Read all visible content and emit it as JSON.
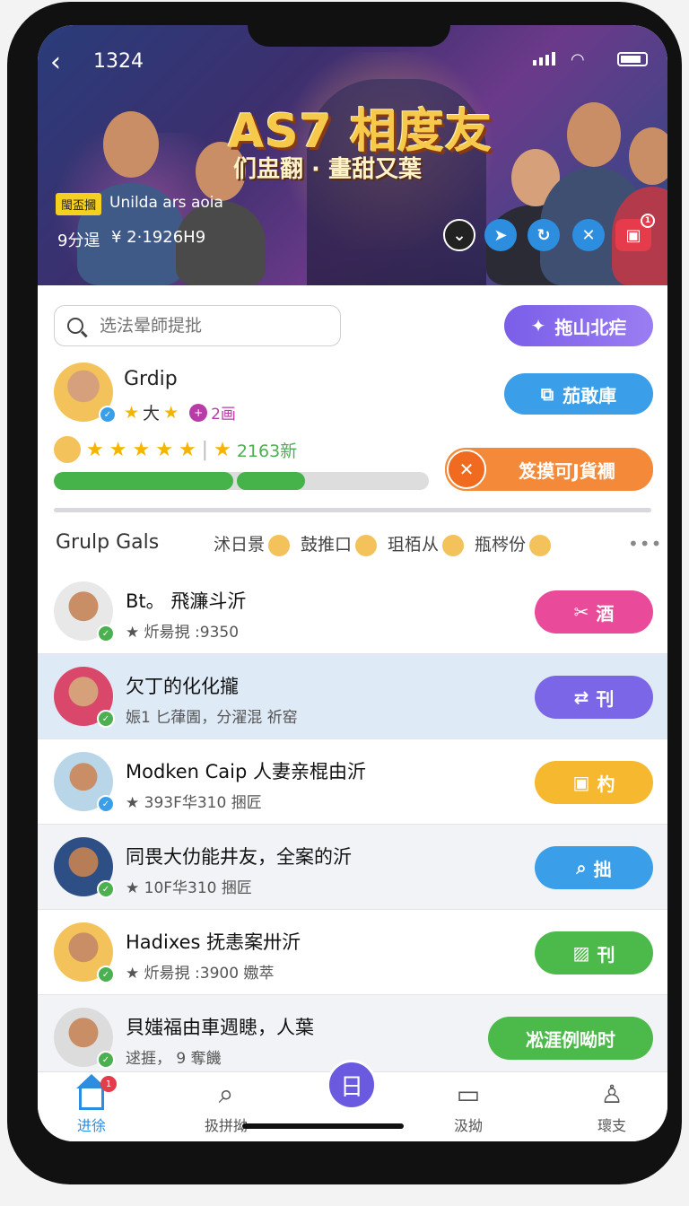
{
  "status": {
    "time": "1324"
  },
  "banner": {
    "title": "AS7 相度友",
    "subtitle": "们盅翻 · 畫甜又葉",
    "tag": "閩盃摑",
    "tag_text": "Unilda ars aoia",
    "meta_left": "9分逞",
    "meta_right": "¥ 2·1926H9",
    "notification_count": "1"
  },
  "search": {
    "placeholder": "选法晕師提批"
  },
  "top_button": "拖山北疟",
  "profile": {
    "name": "Grdip",
    "stars_label": "大",
    "purple_value": "2画",
    "follow_button": "茄敢庫",
    "rating_value": "2163新",
    "progress": 0.62
  },
  "promo_button": "笈摸可J貨襉",
  "section": {
    "title": "Grulp Gals",
    "filters": [
      "沭日景",
      "鼓推口",
      "珇栢从",
      "瓶梣份"
    ]
  },
  "rows": [
    {
      "title": "Bt。 飛濂斗沂",
      "sub": "★ 炘昜挸  :9350",
      "action": "酒"
    },
    {
      "title": "欠丁的化化攏",
      "sub": "娠1 匕葎圊，分濯混 祈窑",
      "action": "刊"
    },
    {
      "title": "Modken Caip 人妻亲棍由沂",
      "sub": "★ 393F华310 捆匠",
      "action": "杓"
    },
    {
      "title": "同畏大仂能井友，全案的沂",
      "sub": "★ 10F华310 捆匠",
      "action": "拙"
    },
    {
      "title": "Hadixes 抚恚案卅沂",
      "sub": "★ 炘昜挸  :3900  嫐萃",
      "action": "刊"
    },
    {
      "title": "貝媸福由車週瞣，人葉",
      "sub": "逑捱，  9 奪饑",
      "action": "凇涯例呦时"
    }
  ],
  "tabs": [
    {
      "label": "进徐"
    },
    {
      "label": "扱拼拗"
    },
    {
      "label": ""
    },
    {
      "label": "汲拗"
    },
    {
      "label": "瓌支"
    }
  ],
  "tab_badges": {
    "home": "1"
  },
  "colors": {
    "accent": "#2d8ee0",
    "purple": "#7a5ee8",
    "green": "#46b24a",
    "orange": "#f4893a"
  }
}
